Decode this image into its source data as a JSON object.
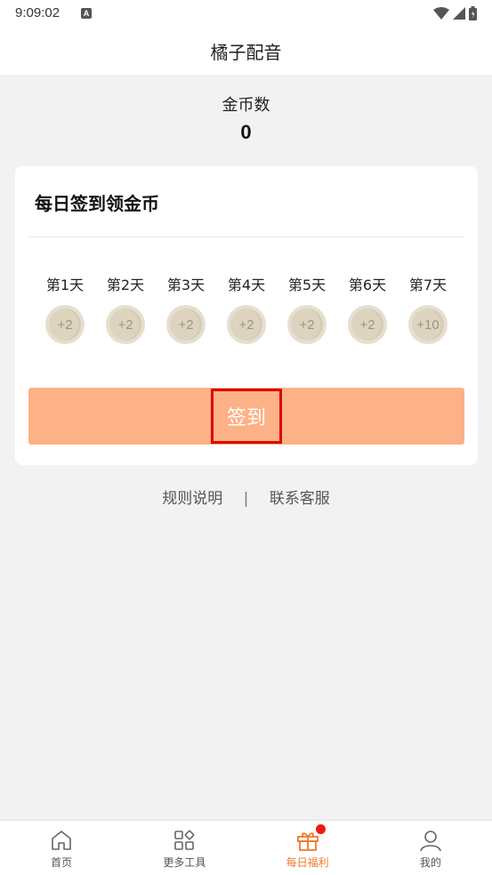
{
  "status_bar": {
    "time": "9:09:02",
    "notification_icon_letter": "A",
    "icons": [
      "wifi-icon",
      "signal-icon",
      "battery-icon"
    ]
  },
  "header": {
    "title": "橘子配音"
  },
  "coins": {
    "label": "金币数",
    "value": "0"
  },
  "checkin_card": {
    "title": "每日签到领金币",
    "days": [
      {
        "label": "第1天",
        "reward": "+2"
      },
      {
        "label": "第2天",
        "reward": "+2"
      },
      {
        "label": "第3天",
        "reward": "+2"
      },
      {
        "label": "第4天",
        "reward": "+2"
      },
      {
        "label": "第5天",
        "reward": "+2"
      },
      {
        "label": "第6天",
        "reward": "+2"
      },
      {
        "label": "第7天",
        "reward": "+10"
      }
    ],
    "button_label": "签到"
  },
  "links": {
    "rules": "规则说明",
    "separator": "|",
    "support": "联系客服"
  },
  "tabbar": {
    "items": [
      {
        "label": "首页",
        "icon": "home-icon",
        "active": false
      },
      {
        "label": "更多工具",
        "icon": "apps-icon",
        "active": false
      },
      {
        "label": "每日福利",
        "icon": "gift-icon",
        "active": true,
        "badge": true
      },
      {
        "label": "我的",
        "icon": "user-icon",
        "active": false
      }
    ]
  },
  "colors": {
    "accent": "#f07a2e",
    "button_bg": "#fdb187",
    "highlight_box": "#e00000",
    "badge": "#ee1c0f",
    "coin": "#e6dfcf"
  }
}
